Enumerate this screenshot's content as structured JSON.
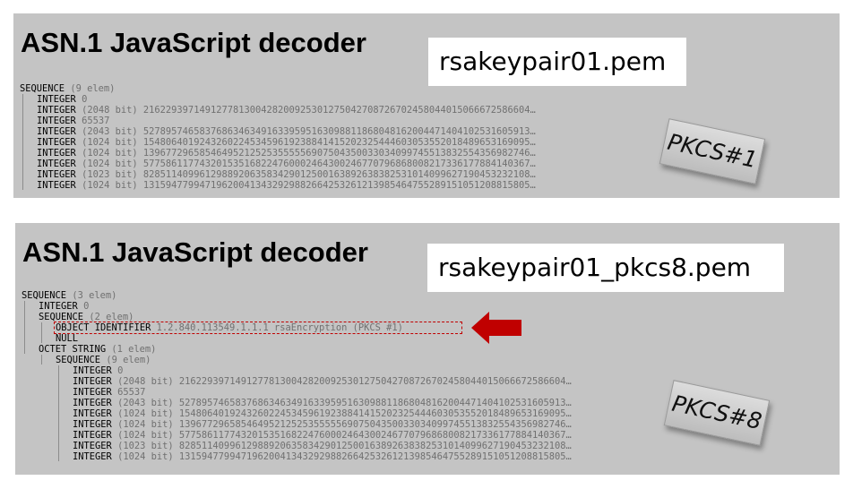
{
  "panel1": {
    "title": "ASN.1 JavaScript decoder",
    "filename": "rsakeypair01.pem",
    "badge": "PKCS#1",
    "rows": [
      {
        "type": "SEQUENCE",
        "info": "(9 elem)",
        "value": "",
        "indent": 0
      },
      {
        "type": "INTEGER",
        "info": "",
        "value": "0",
        "indent": 1
      },
      {
        "type": "INTEGER",
        "info": "(2048 bit)",
        "value": "216229397149127781300428200925301275042708726702458044015066672586604…",
        "indent": 1
      },
      {
        "type": "INTEGER",
        "info": "",
        "value": "65537",
        "indent": 1
      },
      {
        "type": "INTEGER",
        "info": "(2043 bit)",
        "value": "527895746583768634634916339595163098811868048162004471404102531605913…",
        "indent": 1
      },
      {
        "type": "INTEGER",
        "info": "(1024 bit)",
        "value": "154806401924326022453459619238841415202325444603053552018489653169095…",
        "indent": 1
      },
      {
        "type": "INTEGER",
        "info": "(1024 bit)",
        "value": "139677296585464952125253555556907504350033034099745513832554356982746…",
        "indent": 1
      },
      {
        "type": "INTEGER",
        "info": "(1024 bit)",
        "value": "577586117743201535168224760002464300246770796868008217336177884140367…",
        "indent": 1
      },
      {
        "type": "INTEGER",
        "info": "(1023 bit)",
        "value": "828511409961298892063583429012500163892638382531014099627190453232108…",
        "indent": 1
      },
      {
        "type": "INTEGER",
        "info": "(1024 bit)",
        "value": "131594779947196200413432929882664253261213985464755289151051208815805…",
        "indent": 1
      }
    ]
  },
  "panel2": {
    "title": "ASN.1 JavaScript decoder",
    "filename": "rsakeypair01_pkcs8.pem",
    "badge": "PKCS#8",
    "rows": [
      {
        "type": "SEQUENCE",
        "info": "(3 elem)",
        "value": "",
        "indent": 0
      },
      {
        "type": "INTEGER",
        "info": "",
        "value": "0",
        "indent": 1
      },
      {
        "type": "SEQUENCE",
        "info": "(2 elem)",
        "value": "",
        "indent": 1
      },
      {
        "type": "OBJECT IDENTIFIER",
        "info": "",
        "value": "1.2.840.113549.1.1.1",
        "comment": "rsaEncryption (PKCS #1)",
        "indent": 2,
        "highlight": true
      },
      {
        "type": "NULL",
        "info": "",
        "value": "",
        "indent": 2
      },
      {
        "type": "OCTET STRING",
        "info": "(1 elem)",
        "value": "",
        "indent": 1
      },
      {
        "type": "SEQUENCE",
        "info": "(9 elem)",
        "value": "",
        "indent": 2
      },
      {
        "type": "INTEGER",
        "info": "",
        "value": "0",
        "indent": 3
      },
      {
        "type": "INTEGER",
        "info": "(2048 bit)",
        "value": "216229397149127781300428200925301275042708726702458044015066672586604…",
        "indent": 3
      },
      {
        "type": "INTEGER",
        "info": "",
        "value": "65537",
        "indent": 3
      },
      {
        "type": "INTEGER",
        "info": "(2043 bit)",
        "value": "527895746583768634634916339595163098811868048162004471404102531605913…",
        "indent": 3
      },
      {
        "type": "INTEGER",
        "info": "(1024 bit)",
        "value": "154806401924326022453459619238841415202325444603053552018489653169095…",
        "indent": 3
      },
      {
        "type": "INTEGER",
        "info": "(1024 bit)",
        "value": "139677296585464952125253555556907504350033034099745513832554356982746…",
        "indent": 3
      },
      {
        "type": "INTEGER",
        "info": "(1024 bit)",
        "value": "577586117743201535168224760002464300246770796868008217336177884140367…",
        "indent": 3
      },
      {
        "type": "INTEGER",
        "info": "(1023 bit)",
        "value": "828511409961298892063583429012500163892638382531014099627190453232108…",
        "indent": 3
      },
      {
        "type": "INTEGER",
        "info": "(1024 bit)",
        "value": "131594779947196200413432929882664253261213985464755289151051208815805…",
        "indent": 3
      }
    ]
  },
  "colors": {
    "panel_bg": "#c4c4c4",
    "highlight_border": "#c00000",
    "arrow": "#c00000",
    "dim_text": "#707070"
  },
  "icons": {
    "pointer": "red-left-arrow-icon"
  }
}
